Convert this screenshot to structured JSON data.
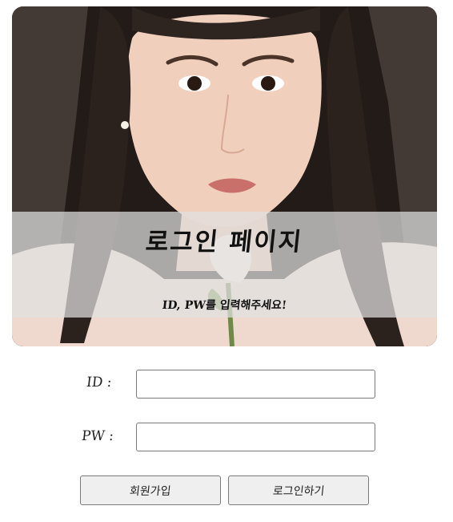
{
  "hero": {
    "photo_icon": "portrait-photo",
    "title": "로그인 페이지",
    "subtitle": "ID, PW를 입력해주세요!"
  },
  "form": {
    "id_label": "ID :",
    "id_value": "",
    "pw_label": "PW :",
    "pw_value": ""
  },
  "buttons": {
    "signup": "회원가입",
    "login": "로그인하기"
  }
}
